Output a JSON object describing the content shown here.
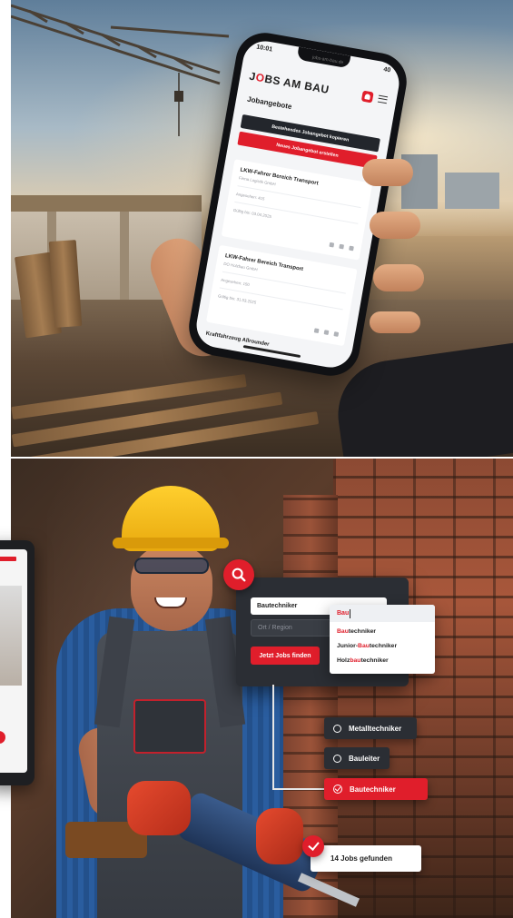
{
  "phone": {
    "time": "10:01",
    "url": "jobs-am-bau.de",
    "battery": "40",
    "logo": {
      "part1": "J",
      "part2": "O",
      "part3": "BS AM BAU"
    },
    "section_title": "Jobangebote",
    "copy_button": "Bestehendes Jobangebot kopieren",
    "new_button": "Neues Jobangebot erstellen",
    "jobs": [
      {
        "title": "LKW-Fahrer Bereich Transport",
        "company": "Firma Logistik GmbH",
        "views": "Angesehen: 415",
        "date": "Gültig bis: 03.04.2025"
      },
      {
        "title": "LKW-Fahrer Bereich Transport",
        "company": "DO Holzbau GmbH",
        "views": "Angesehen: 150",
        "date": "Gültig bis: 31.03.2025"
      }
    ],
    "last_job": "Kraftfahrzeug Allrounder"
  },
  "search": {
    "job_field": "Bautechniker",
    "location_placeholder": "Ort / Region",
    "button": "Jetzt Jobs finden",
    "dropdown_query": "Bau",
    "suggestions": [
      {
        "pre": "",
        "hl": "Bau",
        "post": "techniker"
      },
      {
        "pre": "Junior-",
        "hl": "Bau",
        "post": "techniker"
      },
      {
        "pre": "Holz",
        "hl": "bau",
        "post": "techniker"
      }
    ]
  },
  "filters": {
    "options": [
      "Metalltechniker",
      "Bauleiter"
    ],
    "selected": "Bautechniker"
  },
  "result": {
    "text": "14 Jobs gefunden"
  },
  "colors": {
    "brand_red": "#e01e2b",
    "dark_panel": "#2b2e34"
  }
}
